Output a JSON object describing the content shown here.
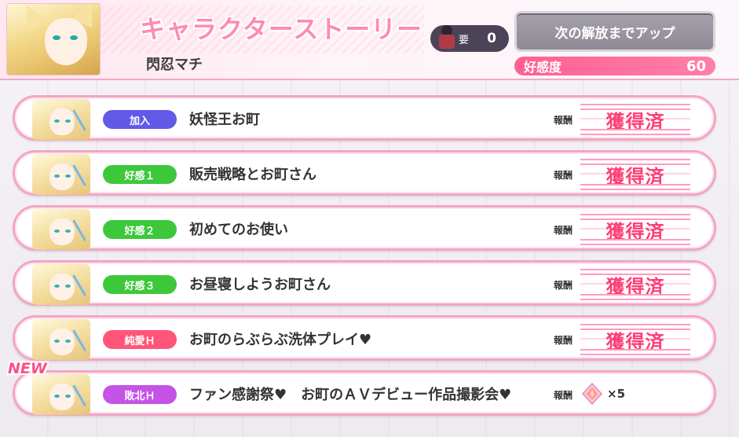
{
  "header": {
    "title": "キャラクターストーリー",
    "character_name": "閃忍マチ",
    "required_label": "要",
    "required_count": "0",
    "unlock_button": "次の解放までアップ",
    "affinity_label": "好感度",
    "affinity_value": "60"
  },
  "reward_label": "報酬",
  "acquired_label": "獲得済",
  "new_label": "NEW",
  "stories": [
    {
      "badge": "加入",
      "badge_color": "#6259e8",
      "title": "妖怪王お町",
      "acquired": true
    },
    {
      "badge": "好感１",
      "badge_color": "#3cc83a",
      "title": "販売戦略とお町さん",
      "acquired": true
    },
    {
      "badge": "好感２",
      "badge_color": "#3cc83a",
      "title": "初めてのお使い",
      "acquired": true
    },
    {
      "badge": "好感３",
      "badge_color": "#3cc83a",
      "title": "お昼寝しようお町さん",
      "acquired": true
    },
    {
      "badge": "純愛Ｈ",
      "badge_color": "#ff5579",
      "title": "お町のらぶらぶ洗体プレイ♥",
      "acquired": true
    },
    {
      "badge": "敗北Ｈ",
      "badge_color": "#c453e6",
      "title": "ファン感謝祭♥　お町のＡＶデビュー作品撮影会♥",
      "acquired": false,
      "reward_icon": "crystal-gem-icon",
      "reward_qty": "×5"
    }
  ]
}
